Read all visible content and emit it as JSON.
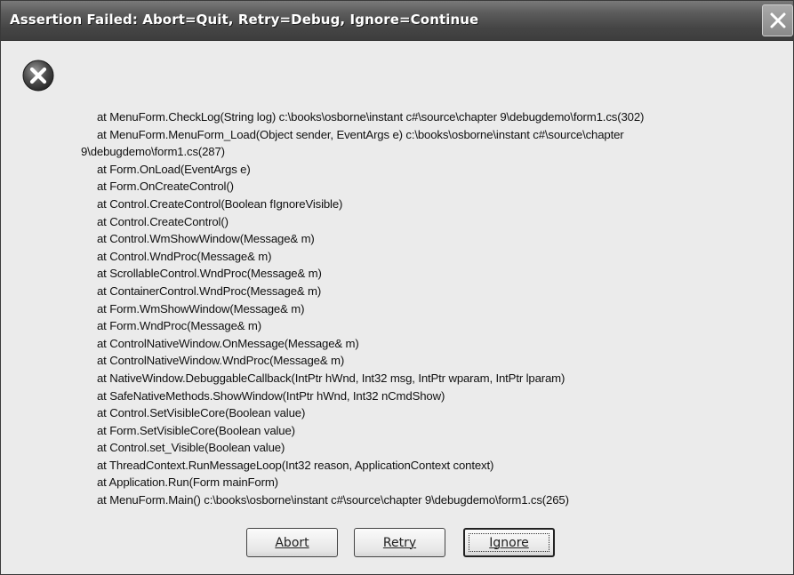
{
  "window": {
    "title": "Assertion Failed: Abort=Quit, Retry=Debug, Ignore=Continue"
  },
  "icons": {
    "error": "error-circle-x-icon",
    "close": "close-x-icon"
  },
  "stack_trace": [
    {
      "text": "at MenuForm.CheckLog(String log)  c:\\books\\osborne\\instant c#\\source\\chapter 9\\debugdemo\\form1.cs(302)"
    },
    {
      "text": "at MenuForm.MenuForm_Load(Object sender, EventArgs e)  c:\\books\\osborne\\instant c#\\source\\chapter",
      "continuation": "9\\debugdemo\\form1.cs(287)"
    },
    {
      "text": "at Form.OnLoad(EventArgs e)"
    },
    {
      "text": "at Form.OnCreateControl()"
    },
    {
      "text": "at Control.CreateControl(Boolean fIgnoreVisible)"
    },
    {
      "text": "at Control.CreateControl()"
    },
    {
      "text": "at Control.WmShowWindow(Message& m)"
    },
    {
      "text": "at Control.WndProc(Message& m)"
    },
    {
      "text": "at ScrollableControl.WndProc(Message& m)"
    },
    {
      "text": "at ContainerControl.WndProc(Message& m)"
    },
    {
      "text": "at Form.WmShowWindow(Message& m)"
    },
    {
      "text": "at Form.WndProc(Message& m)"
    },
    {
      "text": "at ControlNativeWindow.OnMessage(Message& m)"
    },
    {
      "text": "at ControlNativeWindow.WndProc(Message& m)"
    },
    {
      "text": "at NativeWindow.DebuggableCallback(IntPtr hWnd, Int32 msg, IntPtr wparam, IntPtr lparam)"
    },
    {
      "text": "at SafeNativeMethods.ShowWindow(IntPtr hWnd, Int32 nCmdShow)"
    },
    {
      "text": "at Control.SetVisibleCore(Boolean value)"
    },
    {
      "text": "at Form.SetVisibleCore(Boolean value)"
    },
    {
      "text": "at Control.set_Visible(Boolean value)"
    },
    {
      "text": "at ThreadContext.RunMessageLoop(Int32 reason, ApplicationContext context)"
    },
    {
      "text": "at Application.Run(Form mainForm)"
    },
    {
      "text": "at MenuForm.Main()  c:\\books\\osborne\\instant c#\\source\\chapter 9\\debugdemo\\form1.cs(265)"
    }
  ],
  "buttons": {
    "abort": "Abort",
    "retry": "Retry",
    "ignore": "Ignore"
  }
}
